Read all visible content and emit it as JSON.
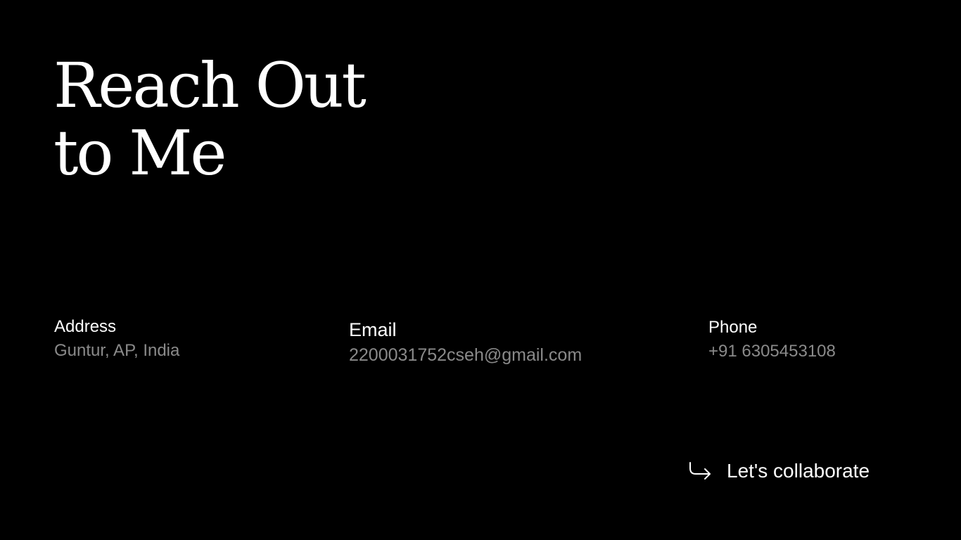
{
  "heading": {
    "line1": "Reach Out",
    "line2": "to Me"
  },
  "contact": {
    "address": {
      "label": "Address",
      "value": "Guntur, AP, India"
    },
    "email": {
      "label": "Email",
      "value": "2200031752cseh@gmail.com"
    },
    "phone": {
      "label": "Phone",
      "value": "+91 6305453108"
    }
  },
  "cta": {
    "label": "Let's collaborate",
    "icon": "arrow-turn-down-right-icon"
  },
  "colors": {
    "background": "#000000",
    "primary_text": "#ffffff",
    "secondary_text": "#8a8a8a"
  }
}
